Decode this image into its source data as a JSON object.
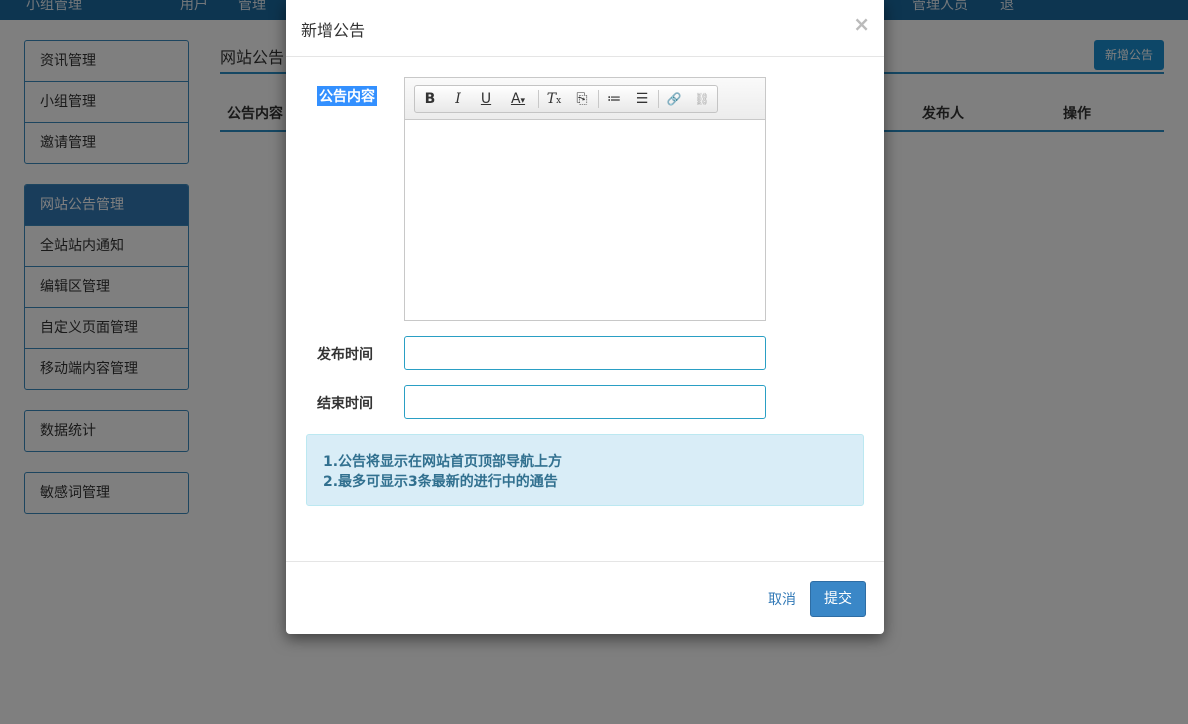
{
  "topbar": {
    "items": [
      "小组管理",
      "用户",
      "管理"
    ],
    "right_items": [
      "管理人员",
      "退"
    ]
  },
  "sidebar": {
    "groups": [
      [
        "资讯管理",
        "小组管理",
        "邀请管理"
      ],
      [
        "网站公告管理",
        "全站站内通知",
        "编辑区管理",
        "自定义页面管理",
        "移动端内容管理"
      ],
      [
        "数据统计"
      ],
      [
        "敏感词管理"
      ]
    ]
  },
  "page": {
    "title": "网站公告",
    "add_button": "新增公告",
    "columns": [
      "公告内容",
      "发布人",
      "操作"
    ]
  },
  "modal": {
    "title": "新增公告",
    "close": "×",
    "content_label": "公告内容",
    "publish_label": "发布时间",
    "end_label": "结束时间",
    "publish_value": "",
    "end_value": "",
    "toolbar": {
      "bold": "B",
      "italic": "I",
      "underline": "U",
      "font_color": "A",
      "remove_format": "T",
      "paste": "⎘",
      "ordered_list": "≔",
      "bullet_list": "☰",
      "link": "🔗",
      "unlink": "⛓"
    },
    "notes": [
      "1.公告将显示在网站首页顶部导航上方",
      "2.最多可显示3条最新的进行中的通告"
    ],
    "cancel": "取消",
    "submit": "提交"
  }
}
